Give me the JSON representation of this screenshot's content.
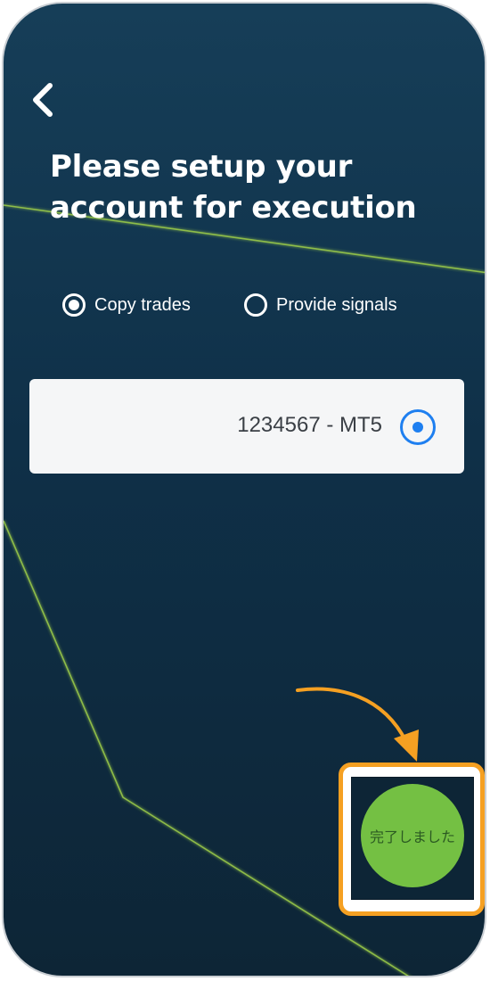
{
  "page": {
    "title": "Please setup your account for execution"
  },
  "mode": {
    "options": [
      {
        "label": "Copy trades",
        "selected": true
      },
      {
        "label": "Provide signals",
        "selected": false
      }
    ]
  },
  "account": {
    "label": "1234567 - MT5",
    "selected": true
  },
  "done": {
    "label": "完了しました"
  },
  "icons": {
    "back": "chevron-left-icon",
    "pointer": "curved-arrow-icon"
  },
  "colors": {
    "background_top": "#163e58",
    "background_bottom": "#0d2536",
    "accent_line": "#9ccc4a",
    "radio_blue": "#1e7ff0",
    "done_button": "#74c043",
    "highlight": "#f5a022"
  }
}
